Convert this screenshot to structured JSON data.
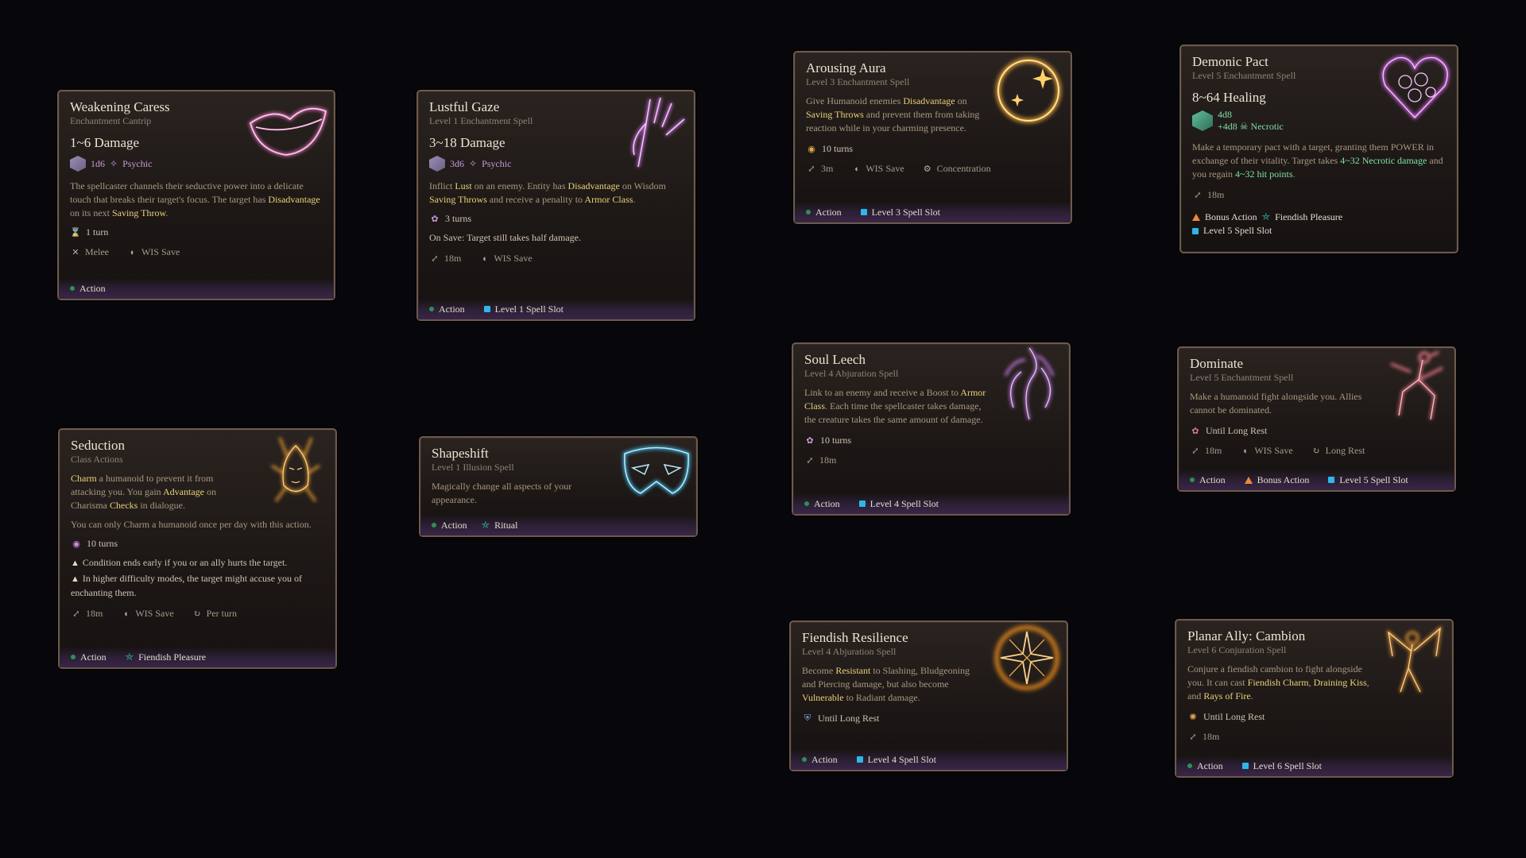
{
  "colors": {
    "background": "#07060a",
    "card_border": "#6d5a4c",
    "highlight": "#e9d178",
    "psychic": "#c99ad8",
    "action_dot": "#2f8f55",
    "spell_slot": "#2fb7e8",
    "bonus_action": "#f0883a",
    "necrotic": "#7fe0a4"
  },
  "cards": {
    "weakening_caress": {
      "title": "Weakening Caress",
      "subtitle": "Enchantment Cantrip",
      "amount": "1~6 Damage",
      "dice": "1d6",
      "dtype": "Psychic",
      "desc": [
        "The spellcaster channels their seductive power into a delicate touch that breaks their target's focus. The target has ",
        "Disadvantage",
        " on its next ",
        "Saving Throw",
        "."
      ],
      "duration": "1 turn",
      "range": "Melee",
      "save": "WIS Save",
      "action": "Action",
      "art_icon": "lips-icon"
    },
    "lustful_gaze": {
      "title": "Lustful Gaze",
      "subtitle": "Level 1 Enchantment Spell",
      "amount": "3~18 Damage",
      "dice": "3d6",
      "dtype": "Psychic",
      "desc": [
        "Inflict ",
        "Lust",
        " on an enemy. Entity has ",
        "Disadvantage",
        " on Wisdom ",
        "Saving Throws",
        " and receive a penality to ",
        "Armor Class",
        "."
      ],
      "duration": "3 turns",
      "on_save": "On Save: Target still takes half damage.",
      "range": "18m",
      "save": "WIS Save",
      "action": "Action",
      "slot": "Level 1 Spell Slot",
      "art_icon": "hand-icon"
    },
    "arousing_aura": {
      "title": "Arousing Aura",
      "subtitle": "Level 3 Enchantment Spell",
      "desc": [
        "Give Humanoid enemies ",
        "Disadvantage",
        " on ",
        "Saving Throws",
        " and prevent them from taking reaction while in your charming presence."
      ],
      "duration": "10 turns",
      "range": "3m",
      "save": "WIS Save",
      "concentration": "Concentration",
      "action": "Action",
      "slot": "Level 3 Spell Slot",
      "art_icon": "ring-sparkle-icon"
    },
    "demonic_pact": {
      "title": "Demonic Pact",
      "subtitle": "Level 5 Enchantment Spell",
      "amount": "8~64 Healing",
      "dice1": "4d8",
      "dice2": "+4d8",
      "dtype": "Necrotic",
      "desc": [
        "Make a temporary pact with a target, granting them POWER in exchange of their vitality. Target takes ",
        "4~32 Necrotic damage",
        " and you regain ",
        "4~32 hit points",
        "."
      ],
      "range": "18m",
      "bonus": "Bonus Action",
      "fiendish": "Fiendish Pleasure",
      "slot": "Level 5 Spell Slot",
      "art_icon": "heart-icon"
    },
    "seduction": {
      "title": "Seduction",
      "subtitle": "Class Actions",
      "desc": [
        "Charm",
        " a humanoid to prevent it from attacking you. You gain ",
        "Advantage",
        " on Charisma ",
        "Checks",
        " in dialogue."
      ],
      "desc2": "You can only Charm a humanoid once per day with this action.",
      "duration": "10 turns",
      "cond1": "Condition ends early if you or an ally hurts the target.",
      "cond2": "In higher difficulty modes, the target might accuse you of enchanting them.",
      "range": "18m",
      "save": "WIS Save",
      "per_turn": "Per turn",
      "action": "Action",
      "fiendish": "Fiendish Pleasure",
      "art_icon": "demon-face-icon"
    },
    "shapeshift": {
      "title": "Shapeshift",
      "subtitle": "Level 1 Illusion Spell",
      "desc": "Magically change all aspects of your appearance.",
      "action": "Action",
      "ritual": "Ritual",
      "art_icon": "mask-icon"
    },
    "soul_leech": {
      "title": "Soul Leech",
      "subtitle": "Level 4 Abjuration Spell",
      "desc": [
        "Link to an enemy and receive a Boost to ",
        "Armor Class",
        ". Each time the spellcaster takes damage, the creature takes the same amount of damage."
      ],
      "duration": "10 turns",
      "range": "18m",
      "action": "Action",
      "slot": "Level 4 Spell Slot",
      "art_icon": "soul-tendrils-icon"
    },
    "dominate": {
      "title": "Dominate",
      "subtitle": "Level 5 Enchantment Spell",
      "desc": "Make a humanoid fight alongside you. Allies cannot be dominated.",
      "duration": "Until Long Rest",
      "range": "18m",
      "save": "WIS Save",
      "long_rest": "Long Rest",
      "action": "Action",
      "bonus": "Bonus Action",
      "slot": "Level 5 Spell Slot",
      "art_icon": "kneeling-figure-icon"
    },
    "fiendish_resilience": {
      "title": "Fiendish Resilience",
      "subtitle": "Level 4 Abjuration Spell",
      "desc": [
        "Become ",
        "Resistant",
        " to Slashing, Bludgeoning and Piercing damage, but also become ",
        "Vulnerable",
        " to Radiant damage."
      ],
      "duration": "Until Long Rest",
      "action": "Action",
      "slot": "Level 4 Spell Slot",
      "art_icon": "star-burst-icon"
    },
    "planar_ally": {
      "title": "Planar Ally: Cambion",
      "subtitle": "Level 6 Conjuration Spell",
      "desc": [
        "Conjure a fiendish cambion to fight alongside you. It can cast ",
        "Fiendish Charm",
        ", ",
        "Draining Kiss",
        ", and ",
        "Rays of Fire",
        "."
      ],
      "duration": "Until Long Rest",
      "range": "18m",
      "action": "Action",
      "slot": "Level 6 Spell Slot",
      "art_icon": "winged-figure-icon"
    }
  }
}
